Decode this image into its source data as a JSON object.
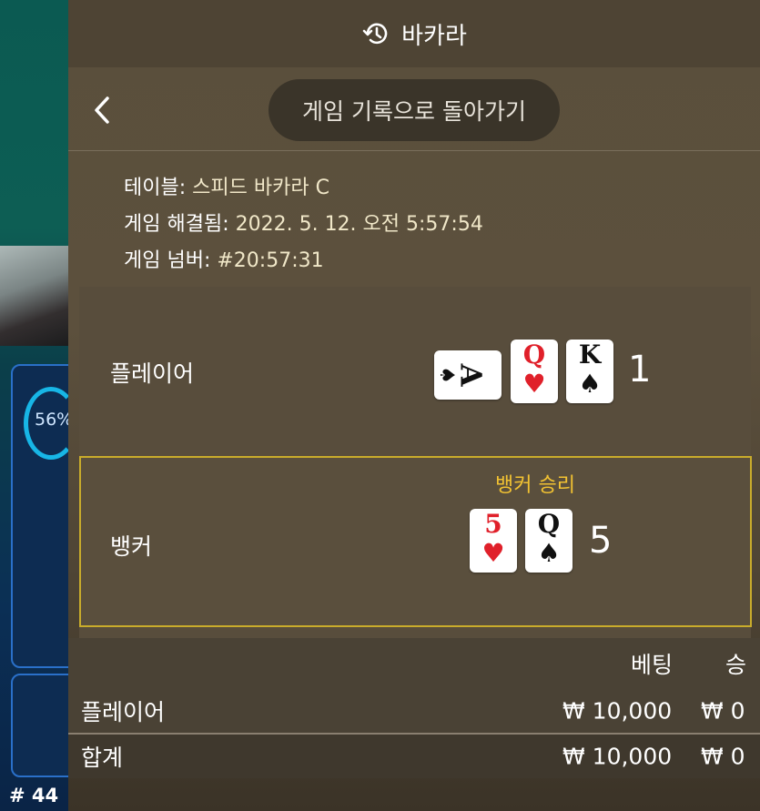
{
  "background": {
    "percent": "56%",
    "table_number": "# 44"
  },
  "header": {
    "title": "바카라",
    "icon": "history-icon"
  },
  "nav": {
    "back_icon": "chevron-left-icon",
    "back_button_label": "게임 기록으로 돌아가기"
  },
  "info": {
    "table_label": "테이블:",
    "table_value": "스피드 바카라 C",
    "resolved_label": "게임 해결됨:",
    "resolved_value": "2022. 5. 12. 오전 5:57:54",
    "number_label": "게임 넘버:",
    "number_value": "#20:57:31"
  },
  "player": {
    "label": "플레이어",
    "cards": [
      {
        "rank": "A",
        "suit": "♠",
        "color": "#111111",
        "orientation": "sideways"
      },
      {
        "rank": "Q",
        "suit": "♥",
        "color": "#e0202a",
        "orientation": "upright"
      },
      {
        "rank": "K",
        "suit": "♠",
        "color": "#111111",
        "orientation": "upright"
      }
    ],
    "score": "1"
  },
  "banker": {
    "label": "뱅커",
    "result": "뱅커 승리",
    "cards": [
      {
        "rank": "5",
        "suit": "♥",
        "color": "#e0202a",
        "orientation": "upright"
      },
      {
        "rank": "Q",
        "suit": "♠",
        "color": "#111111",
        "orientation": "upright"
      }
    ],
    "score": "5"
  },
  "bets": {
    "columns": [
      "베팅",
      "승"
    ],
    "rows": [
      {
        "name": "플레이어",
        "bet": "₩ 10,000",
        "win": "₩ 0"
      }
    ],
    "total": {
      "name": "합계",
      "bet": "₩ 10,000",
      "win": "₩ 0"
    }
  },
  "colors": {
    "accent_gold": "#c9ac2b",
    "winner_text": "#f2c232"
  }
}
